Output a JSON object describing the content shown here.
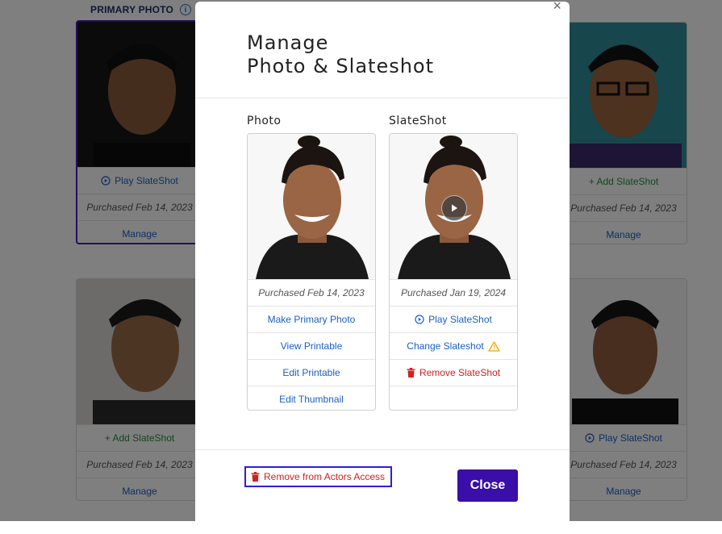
{
  "background": {
    "primary_header": "PRIMARY PHOTO",
    "cards": [
      {
        "action": "Play SlateShot",
        "purchased": "Purchased Feb 14, 2023",
        "manage": "Manage"
      },
      {
        "action": "+ Add SlateShot",
        "purchased": "Purchased Feb 14, 2023",
        "manage": "Manage"
      },
      {
        "action": "+ Add SlateShot",
        "purchased": "Purchased Feb 14, 2023",
        "manage": "Manage"
      },
      {
        "action": "Play SlateShot",
        "purchased": "Purchased Feb 14, 2023",
        "manage": "Manage"
      }
    ]
  },
  "modal": {
    "title_line1": "Manage",
    "title_line2": "Photo & Slateshot",
    "close_x": "×",
    "photo": {
      "label": "Photo",
      "purchased": "Purchased Feb 14, 2023",
      "actions": [
        "Make Primary Photo",
        "View Printable",
        "Edit Printable",
        "Edit Thumbnail"
      ]
    },
    "slateshot": {
      "label": "SlateShot",
      "purchased": "Purchased Jan 19, 2024",
      "play": "Play SlateShot",
      "change": "Change Slateshot",
      "remove": "Remove SlateShot"
    },
    "remove_from_aa": "Remove from Actors Access",
    "close_button": "Close"
  },
  "colors": {
    "brand_purple": "#3a0ea8",
    "link_blue": "#1a5fc7",
    "danger_red": "#d21f1f",
    "add_green": "#2c8a3a",
    "warning_amber": "#f0a500",
    "focus_outline": "#2e1fd6"
  },
  "icons": [
    "info-icon",
    "play-circle-icon",
    "warning-icon",
    "trash-icon",
    "close-icon"
  ]
}
